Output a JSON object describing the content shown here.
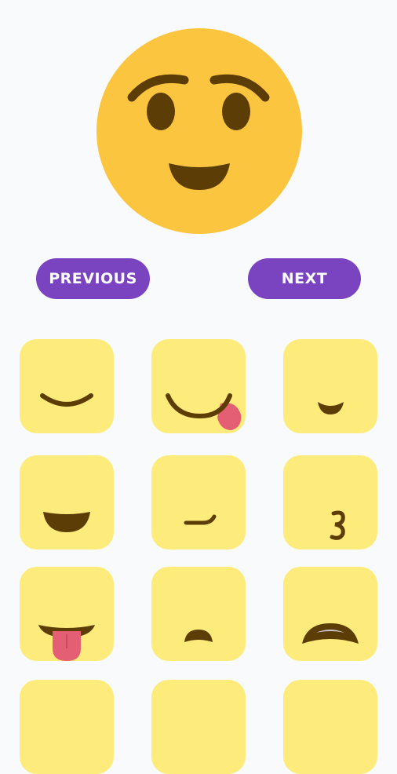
{
  "buttons": {
    "previous_label": "PREVIOUS",
    "next_label": "NEXT"
  },
  "colors": {
    "background": "#f8fafc",
    "face": "#fcc53f",
    "feature": "#5d3d06",
    "tile": "#fdec7c",
    "button": "#7a43bf",
    "tongue": "#e45f74"
  },
  "preview_face": "smiling-face-raised-brows",
  "mouth_options": [
    "closed-smile",
    "smile-tongue-out",
    "small-smile",
    "open-smile",
    "smirk",
    "kiss",
    "tongue-out",
    "small-frown",
    "grimace-teeth",
    "row4-option-1",
    "row4-option-2",
    "row4-option-3"
  ]
}
